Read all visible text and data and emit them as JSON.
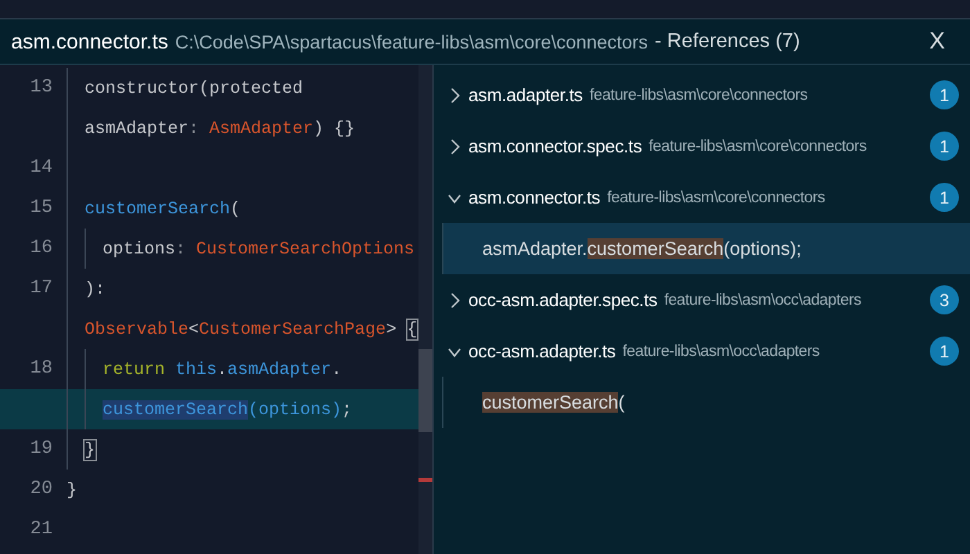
{
  "peek": {
    "file": "asm.connector.ts",
    "path": "C:\\Code\\SPA\\spartacus\\feature-libs\\asm\\core\\connectors",
    "suffix": "- References (7)",
    "close": "X"
  },
  "code": {
    "body": [
      {
        "number": "13",
        "current": false,
        "tokens": [
          {
            "text": "constructor(protected",
            "kind": "plain"
          }
        ]
      },
      {
        "current": false,
        "tokens": [
          {
            "text": "asmAdapter",
            "kind": "plain"
          },
          {
            "text": ": ",
            "kind": "punct"
          },
          {
            "text": "AsmAdapter",
            "kind": "type"
          },
          {
            "text": ") {}",
            "kind": "plain"
          }
        ]
      },
      {
        "number": "14",
        "current": false
      },
      {
        "number": "15",
        "current": false,
        "tokens": [
          {
            "text": "customerSearch",
            "kind": "function"
          },
          {
            "text": "(",
            "kind": "plain"
          }
        ],
        "children": [
          {
            "number": "16",
            "current": false,
            "tokens": [
              {
                "text": "options",
                "kind": "plain"
              },
              {
                "text": ": ",
                "kind": "punct"
              },
              {
                "text": "CustomerSearchOptions",
                "kind": "type"
              }
            ]
          }
        ]
      },
      {
        "number": "17",
        "current": false,
        "tokens": [
          {
            "text": "):",
            "kind": "plain"
          }
        ]
      },
      {
        "current": false,
        "tokens": [
          {
            "text": "Observable",
            "kind": "type"
          },
          {
            "text": "<",
            "kind": "plain"
          },
          {
            "text": "CustomerSearchPage",
            "kind": "type"
          },
          {
            "text": "> ",
            "kind": "plain"
          },
          {
            "text": "{",
            "kind": "plain",
            "bracket_match": true
          }
        ],
        "children": [
          {
            "number": "18",
            "current": false,
            "tokens": [
              {
                "text": "return ",
                "kind": "keyword"
              },
              {
                "text": "this",
                "kind": "function"
              },
              {
                "text": ".",
                "kind": "plain"
              },
              {
                "text": "asmAdapter",
                "kind": "function"
              },
              {
                "text": ".",
                "kind": "plain"
              }
            ]
          },
          {
            "current": true,
            "tokens": [
              {
                "text": "customerSearch",
                "kind": "function",
                "selected": true
              },
              {
                "text": "(options)",
                "kind": "function"
              },
              {
                "text": ";",
                "kind": "plain"
              }
            ]
          }
        ]
      },
      {
        "number": "19",
        "current": false,
        "tokens": [
          {
            "text": "}",
            "kind": "plain",
            "bracket_match": true
          }
        ]
      }
    ],
    "after": [
      {
        "number": "20",
        "current": false,
        "tokens": [
          {
            "text": "}",
            "kind": "plain"
          }
        ]
      },
      {
        "number": "21",
        "current": false
      }
    ]
  },
  "references": [
    {
      "name": "asm.adapter.ts",
      "path": "feature-libs\\asm\\core\\connectors",
      "count": "1",
      "expanded": false
    },
    {
      "name": "asm.connector.spec.ts",
      "path": "feature-libs\\asm\\core\\connectors",
      "count": "1",
      "expanded": false
    },
    {
      "name": "asm.connector.ts",
      "path": "feature-libs\\asm\\core\\connectors",
      "count": "1",
      "expanded": true,
      "matches": [
        {
          "selected": true,
          "parts": [
            {
              "text": "asmAdapter.",
              "match": false
            },
            {
              "text": "customerSearch",
              "match": true
            },
            {
              "text": "(options);",
              "match": false
            }
          ]
        }
      ]
    },
    {
      "name": "occ-asm.adapter.spec.ts",
      "path": "feature-libs\\asm\\occ\\adapters",
      "count": "3",
      "expanded": false
    },
    {
      "name": "occ-asm.adapter.ts",
      "path": "feature-libs\\asm\\occ\\adapters",
      "count": "1",
      "expanded": true,
      "matches": [
        {
          "selected": false,
          "parts": [
            {
              "text": "customerSearch",
              "match": true
            },
            {
              "text": "(",
              "match": false
            }
          ]
        }
      ]
    }
  ]
}
